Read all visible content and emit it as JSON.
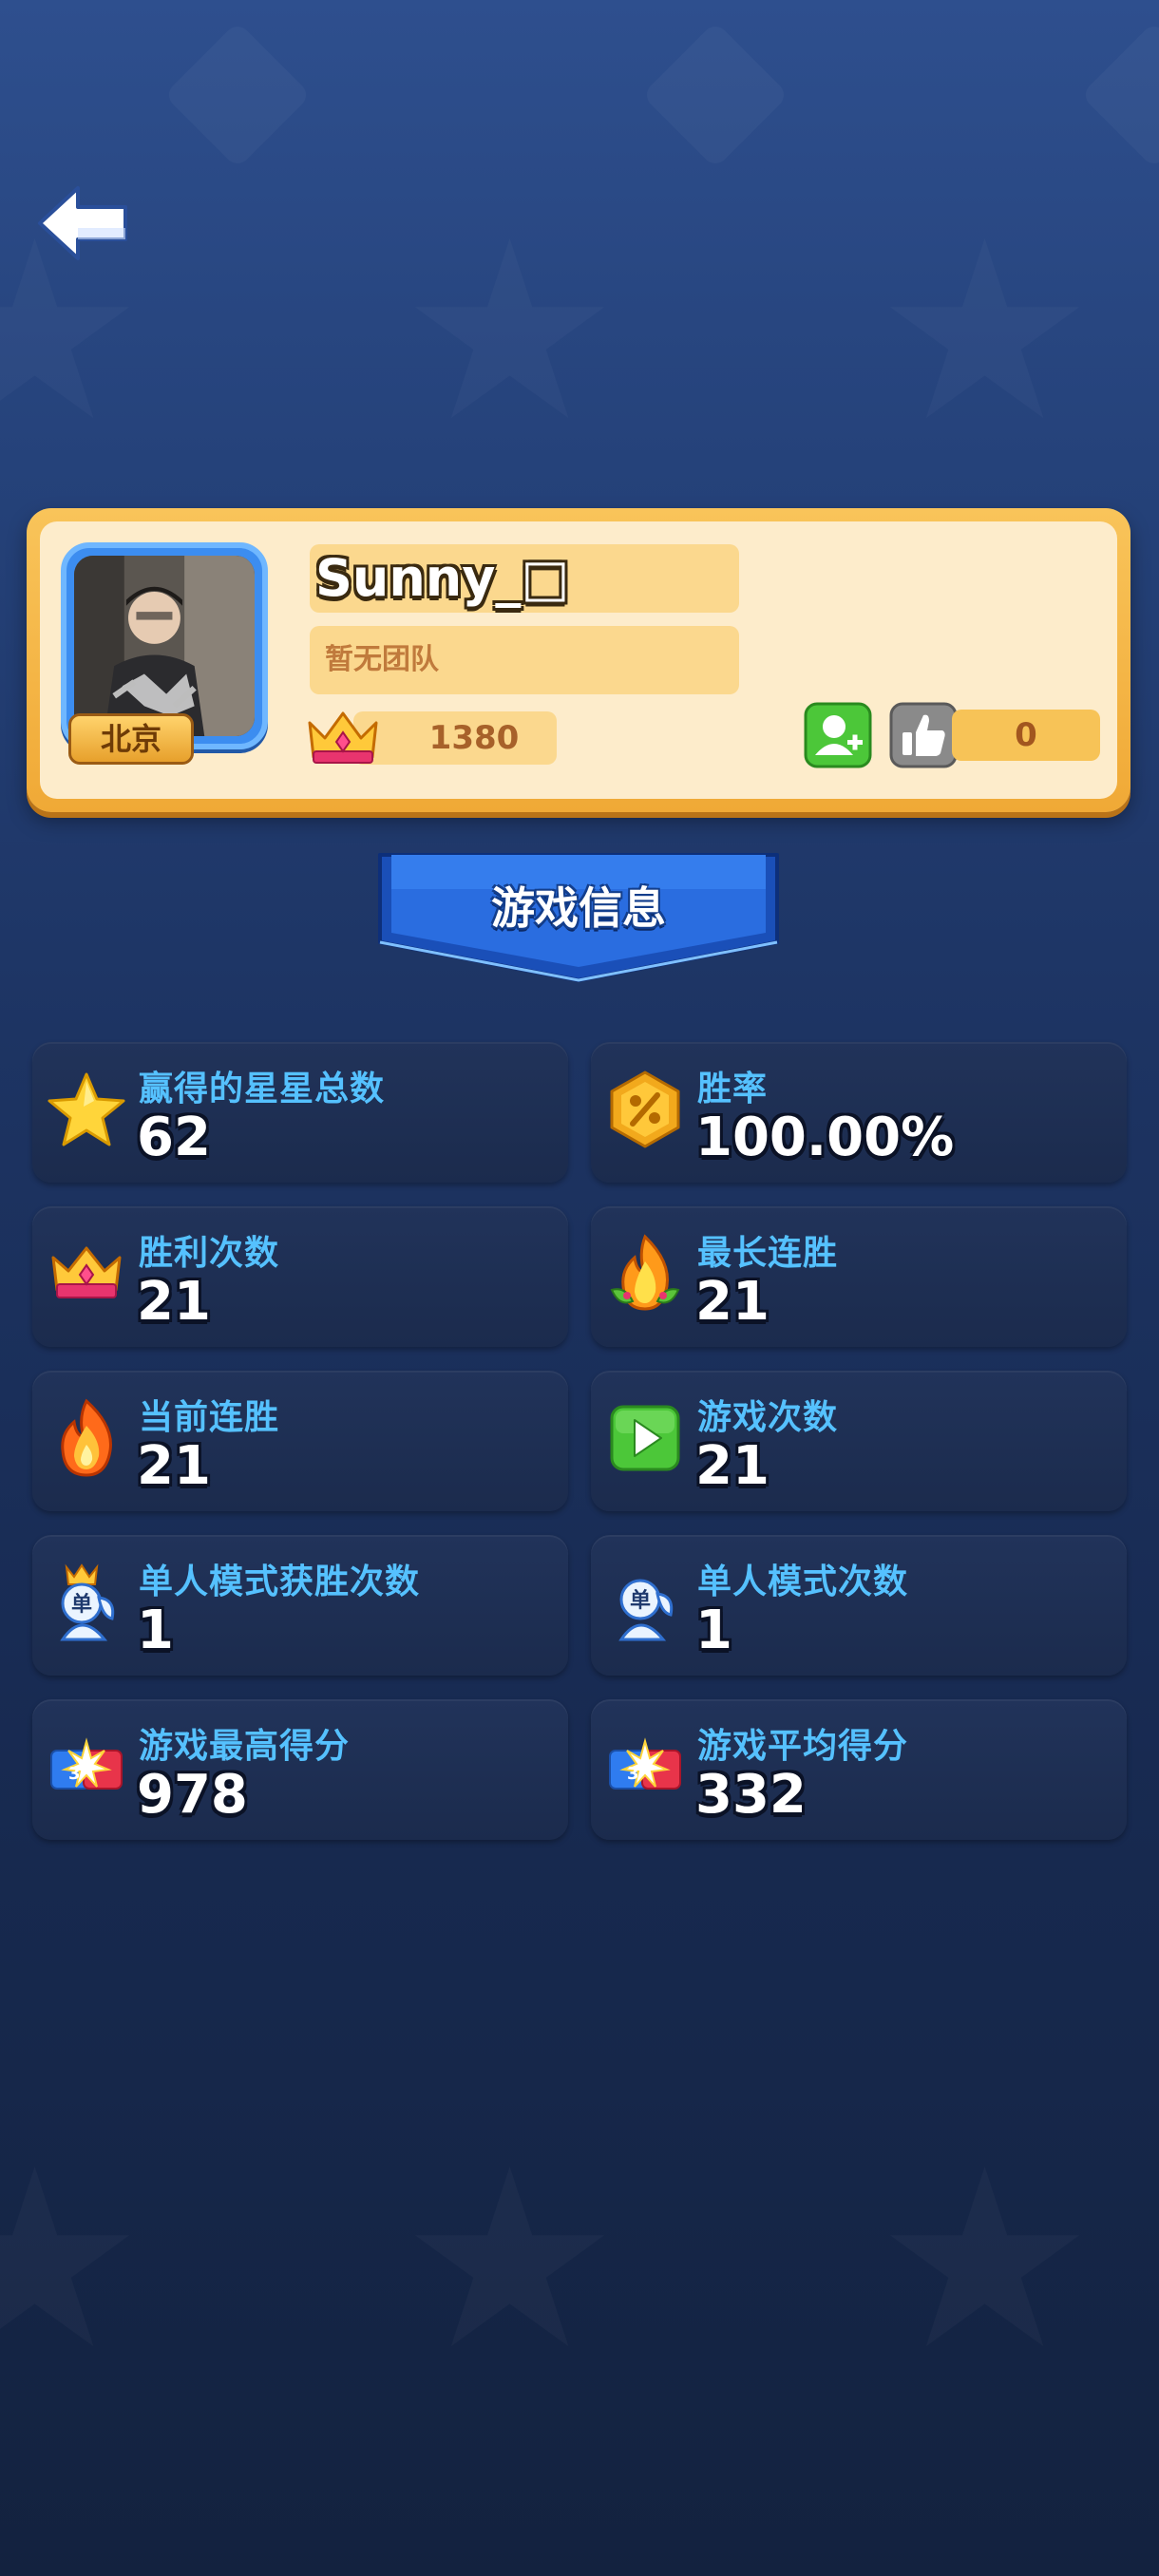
{
  "back": {
    "icon": "back-arrow-icon"
  },
  "profile": {
    "name": "Sunny_□",
    "team": "暂无团队",
    "city": "北京",
    "score": "1380",
    "likes": "0",
    "avatar_icon": "avatar-photo",
    "score_icon": "crown-icon",
    "friend_icon": "add-friend-icon",
    "like_icon": "thumbs-up-icon"
  },
  "section": {
    "title": "游戏信息"
  },
  "stats": [
    {
      "label": "赢得的星星总数",
      "value": "62",
      "icon": "star-icon"
    },
    {
      "label": "胜率",
      "value": "100.00%",
      "icon": "percent-badge-icon"
    },
    {
      "label": "胜利次数",
      "value": "21",
      "icon": "crown-icon"
    },
    {
      "label": "最长连胜",
      "value": "21",
      "icon": "flame-leaf-icon"
    },
    {
      "label": "当前连胜",
      "value": "21",
      "icon": "flame-icon"
    },
    {
      "label": "游戏次数",
      "value": "21",
      "icon": "play-icon"
    },
    {
      "label": "单人模式获胜次数",
      "value": "1",
      "icon": "solo-crown-icon"
    },
    {
      "label": "单人模式次数",
      "value": "1",
      "icon": "solo-icon"
    },
    {
      "label": "游戏最高得分",
      "value": "978",
      "icon": "score-burst-icon"
    },
    {
      "label": "游戏平均得分",
      "value": "332",
      "icon": "score-burst-icon"
    }
  ],
  "colors": {
    "label": "#55c1ff",
    "card_border": "#f0a936",
    "banner": "#2a6de0"
  }
}
